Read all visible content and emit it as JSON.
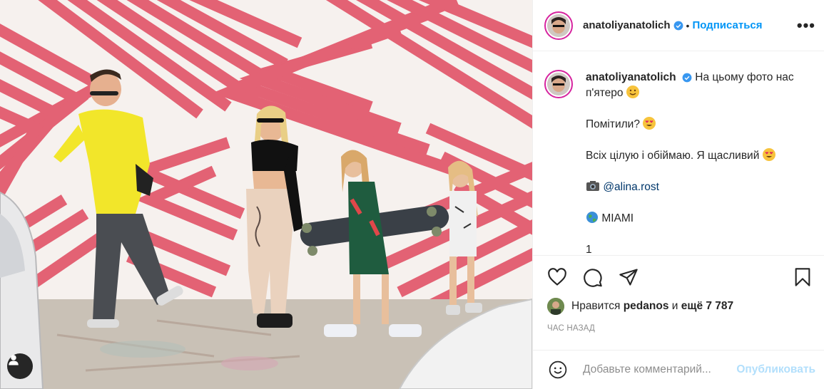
{
  "post": {
    "username": "anatoliyanatolich",
    "dot": "•",
    "follow_label": "Подписаться",
    "more_label": "•••"
  },
  "caption": {
    "username": "anatoliyanatolich",
    "line1": "На цьому фото нас п'ятеро",
    "line2": "Помітили?",
    "line3": "Всіх цілую і обіймаю. Я щасливий",
    "photo_credit": "@alina.rost",
    "location": "MIAMI",
    "truncated_line": "1"
  },
  "likes": {
    "prefix": "Нравится",
    "user": "pedanos",
    "conj": "и",
    "rest": "ещё 7 787"
  },
  "time_label": "ЧАС НАЗАД",
  "comment": {
    "placeholder": "Добавьте комментарий...",
    "post_label": "Опубликовать"
  },
  "colors": {
    "accent": "#0095f6",
    "verified": "#3897f0",
    "stripe": "#e04a5f",
    "post_disabled": "#b2dffc"
  },
  "icons": [
    "heart-icon",
    "comment-icon",
    "share-icon",
    "bookmark-icon",
    "smiley-icon",
    "user-tag-icon",
    "verified-icon",
    "more-icon"
  ]
}
